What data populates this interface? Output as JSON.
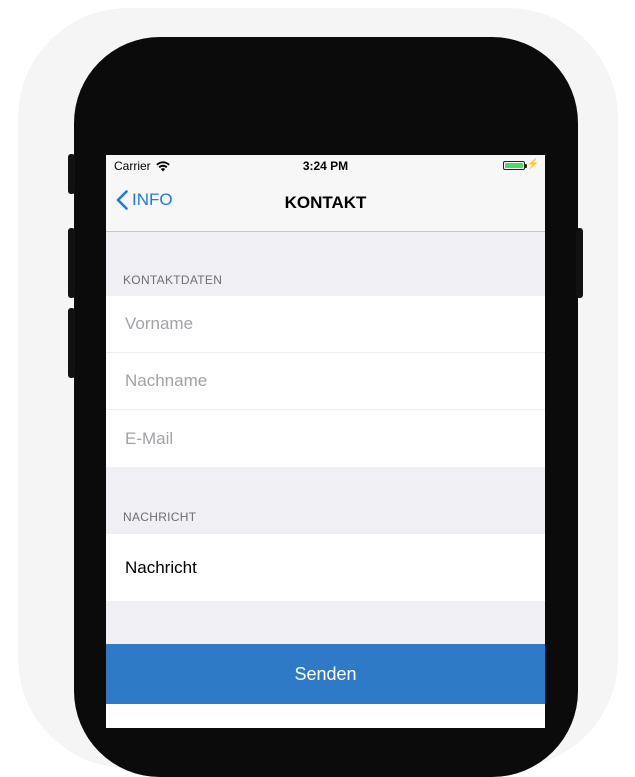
{
  "status_bar": {
    "carrier": "Carrier",
    "time": "3:24 PM",
    "wifi_icon": "wifi-icon",
    "battery_icon": "battery-icon",
    "battery_color": "#4cd964"
  },
  "navbar": {
    "back_label": "INFO",
    "back_icon": "chevron-left-icon",
    "title": "KONTAKT",
    "accent_color": "#1f7ae0"
  },
  "contact_section": {
    "header": "KONTAKTDATEN",
    "fields": [
      {
        "placeholder": "Vorname",
        "value": ""
      },
      {
        "placeholder": "Nachname",
        "value": ""
      },
      {
        "placeholder": "E-Mail",
        "value": ""
      }
    ]
  },
  "message_section": {
    "header": "NACHRICHT",
    "text": "Nachricht"
  },
  "send_button": {
    "label": "Senden",
    "color": "#2f7ac7"
  }
}
